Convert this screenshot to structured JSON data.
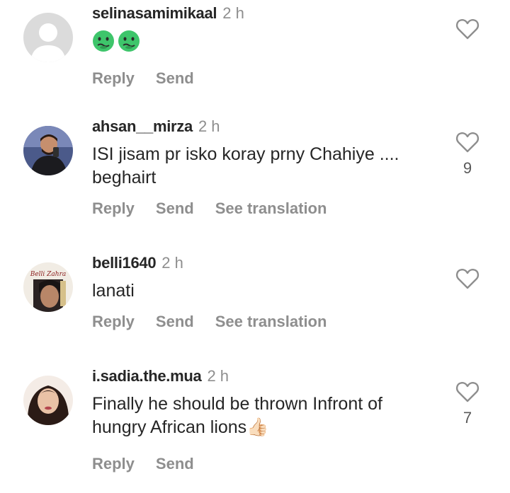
{
  "comments": [
    {
      "username": "selinasamimikaal",
      "time": "2 h",
      "text": "",
      "emojis": [
        "nauseated-face",
        "nauseated-face"
      ],
      "actions": [
        "Reply",
        "Send"
      ],
      "likes": ""
    },
    {
      "username": "ahsan__mirza",
      "time": "2 h",
      "text": "ISI jisam pr isko koray prny Chahiye .... beghairt",
      "actions": [
        "Reply",
        "Send",
        "See translation"
      ],
      "likes": "9"
    },
    {
      "username": "belli1640",
      "time": "2 h",
      "text": "lanati",
      "avatar_text": "Belli Zahra",
      "actions": [
        "Reply",
        "Send",
        "See translation"
      ],
      "likes": ""
    },
    {
      "username": "i.sadia.the.mua",
      "time": "2 h",
      "text": "Finally he should be thrown Infront of hungry African lions👍🏻",
      "actions": [
        "Reply",
        "Send"
      ],
      "likes": "7"
    }
  ],
  "colors": {
    "username": "#262626",
    "meta": "#8e8e8e",
    "heart_outline": "#8e8e8e",
    "emoji_face": "#3ec56b"
  }
}
